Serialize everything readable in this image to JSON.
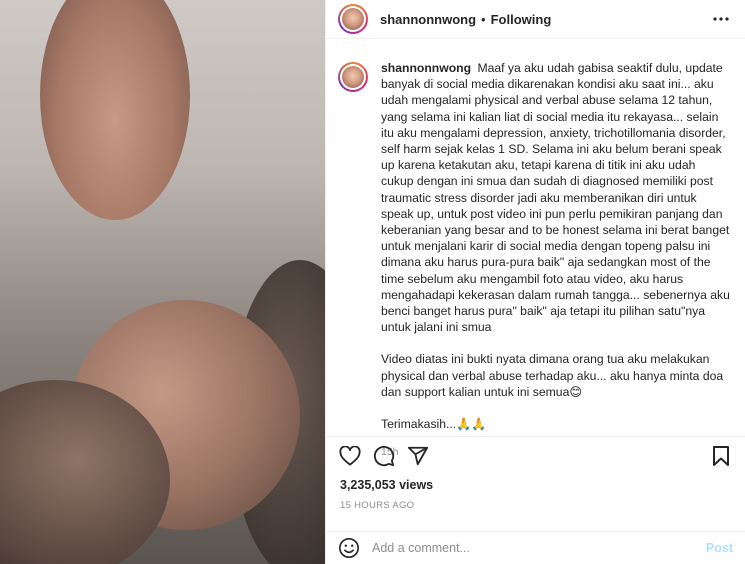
{
  "header": {
    "username": "shannonnwong",
    "separator": "•",
    "follow_status": "Following",
    "more_icon": "more-horizontal-icon"
  },
  "caption": {
    "username": "shannonnwong",
    "paragraph1": "Maaf ya aku udah gabisa seaktif dulu, update banyak di social media dikarenakan kondisi aku saat ini... aku udah mengalami physical and verbal abuse selama 12 tahun, yang selama ini kalian liat di social media itu rekayasa... selain itu aku mengalami depression, anxiety, trichotillomania disorder, self harm sejak kelas 1 SD. Selama ini aku belum berani speak up karena ketakutan aku, tetapi karena di titik ini aku udah cukup dengan ini smua dan sudah di diagnosed memiliki post traumatic stress disorder jadi aku memberanikan diri untuk speak up, untuk post video ini pun perlu pemikiran panjang dan keberanian yang besar and to be honest selama ini berat banget untuk menjalani karir di social media dengan topeng palsu ini dimana aku harus pura-pura baik\" aja sedangkan most of the time sebelum aku mengambil foto atau video, aku harus mengahadapi kekerasan dalam rumah tangga... sebenernya aku benci banget harus pura\" baik\" aja tetapi itu pilihan satu\"nya untuk jalani ini smua",
    "paragraph2": "Video diatas ini bukti nyata dimana orang tua aku melakukan physical dan verbal abuse terhadap aku... aku hanya minta doa dan support kalian untuk ini semua😊",
    "paragraph3": "Terimakasih...🙏🙏",
    "time": "15h"
  },
  "actions": {
    "like_icon": "heart-icon",
    "comment_icon": "comment-icon",
    "share_icon": "share-icon",
    "save_icon": "bookmark-icon"
  },
  "stats": {
    "views": "3,235,053 views",
    "posted": "15 HOURS AGO"
  },
  "comment_box": {
    "placeholder": "Add a comment...",
    "post_label": "Post"
  },
  "colors": {
    "text": "#262626",
    "muted": "#8e8e8e",
    "post_disabled": "#b2dffc",
    "border": "#efefef"
  }
}
